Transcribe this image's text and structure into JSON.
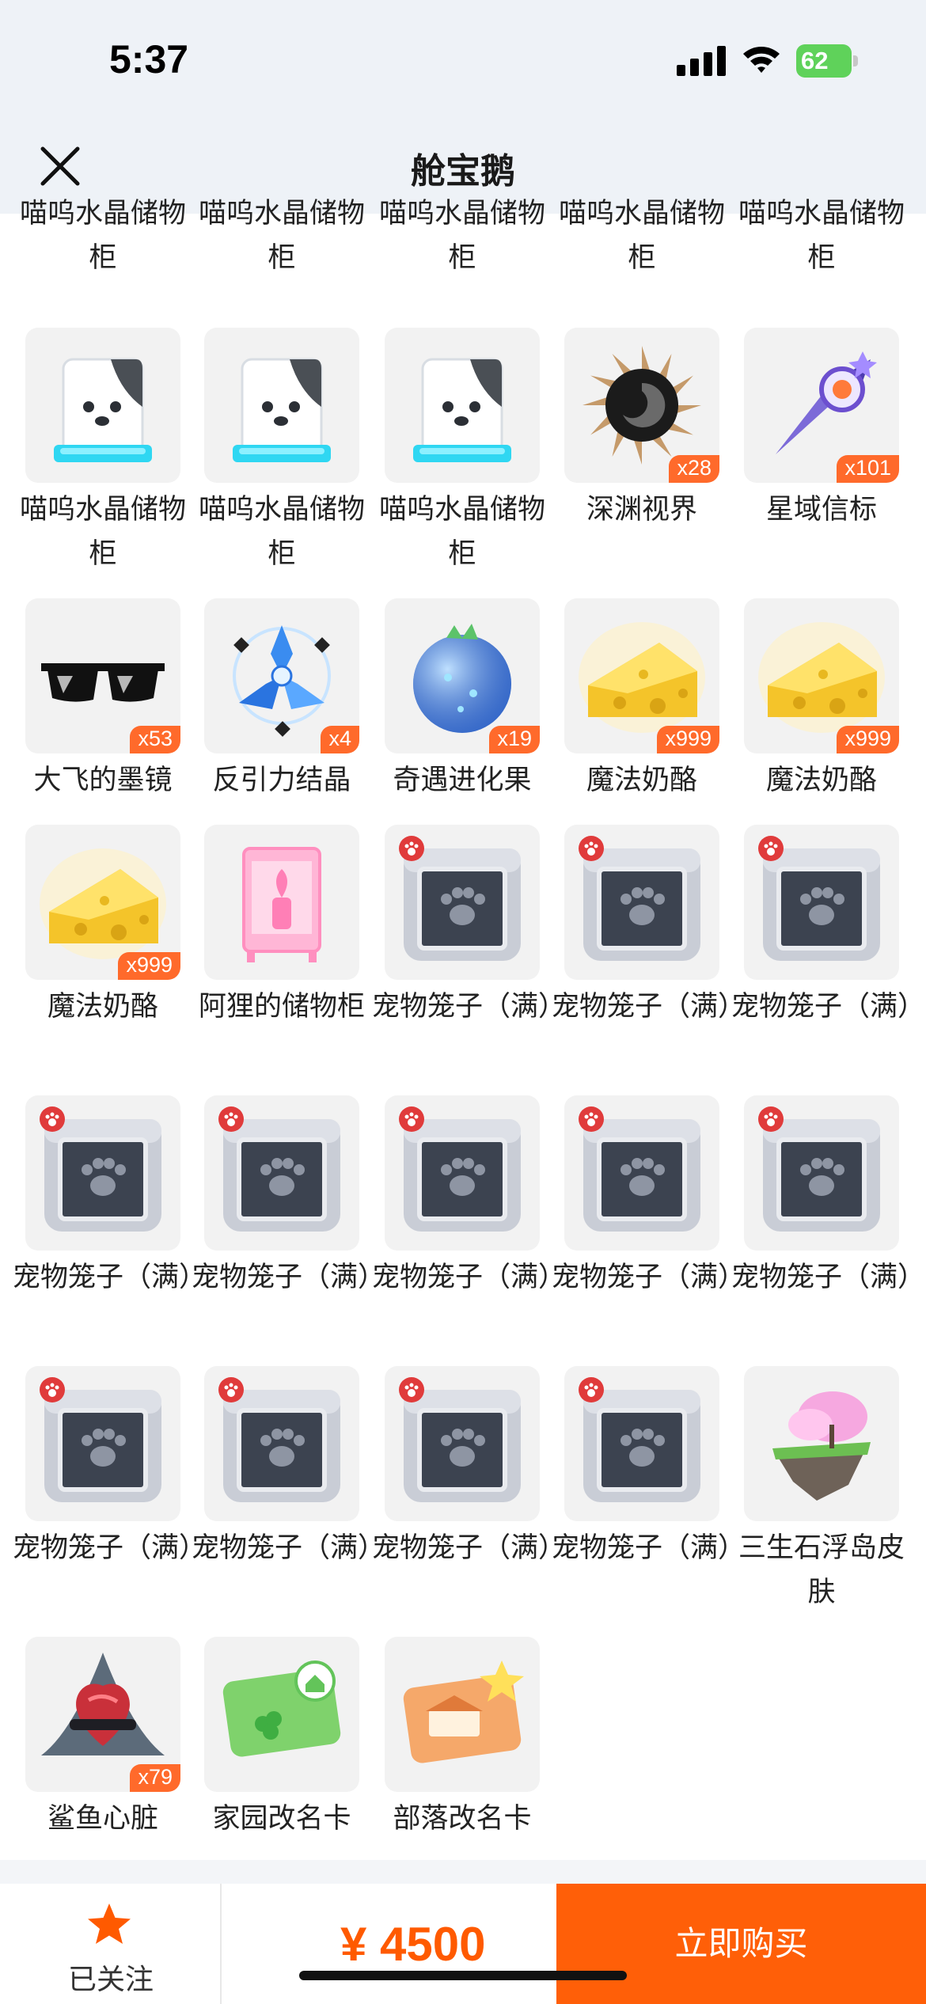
{
  "status_bar": {
    "time": "5:37",
    "battery_percent": "62"
  },
  "header": {
    "title": "舱宝鹅"
  },
  "top_partial_labels": [
    "喵呜水晶储物柜",
    "喵呜水晶储物柜",
    "喵呜水晶储物柜",
    "喵呜水晶储物柜",
    "喵呜水晶储物柜"
  ],
  "items": [
    {
      "label": "喵呜水晶储物柜",
      "count": "",
      "icon": "crystal-cabinet-icon"
    },
    {
      "label": "喵呜水晶储物柜",
      "count": "",
      "icon": "crystal-cabinet-icon"
    },
    {
      "label": "喵呜水晶储物柜",
      "count": "",
      "icon": "crystal-cabinet-icon"
    },
    {
      "label": "深渊视界",
      "count": "x28",
      "icon": "abyss-vision-icon"
    },
    {
      "label": "星域信标",
      "count": "x101",
      "icon": "star-beacon-icon"
    },
    {
      "label": "大飞的墨镜",
      "count": "x53",
      "icon": "sunglasses-icon"
    },
    {
      "label": "反引力结晶",
      "count": "x4",
      "icon": "antigravity-crystal-icon"
    },
    {
      "label": "奇遇进化果",
      "count": "x19",
      "icon": "evolution-fruit-icon"
    },
    {
      "label": "魔法奶酪",
      "count": "x999",
      "icon": "magic-cheese-icon"
    },
    {
      "label": "魔法奶酪",
      "count": "x999",
      "icon": "magic-cheese-icon"
    },
    {
      "label": "魔法奶酪",
      "count": "x999",
      "icon": "magic-cheese-icon"
    },
    {
      "label": "阿狸的储物柜",
      "count": "",
      "icon": "pink-cabinet-icon"
    },
    {
      "label": "宠物笼子（满）",
      "count": "",
      "icon": "pet-cage-icon"
    },
    {
      "label": "宠物笼子（满）",
      "count": "",
      "icon": "pet-cage-icon"
    },
    {
      "label": "宠物笼子（满）",
      "count": "",
      "icon": "pet-cage-icon"
    },
    {
      "label": "宠物笼子（满）",
      "count": "",
      "icon": "pet-cage-icon"
    },
    {
      "label": "宠物笼子（满）",
      "count": "",
      "icon": "pet-cage-icon"
    },
    {
      "label": "宠物笼子（满）",
      "count": "",
      "icon": "pet-cage-icon"
    },
    {
      "label": "宠物笼子（满）",
      "count": "",
      "icon": "pet-cage-icon"
    },
    {
      "label": "宠物笼子（满）",
      "count": "",
      "icon": "pet-cage-icon"
    },
    {
      "label": "宠物笼子（满）",
      "count": "",
      "icon": "pet-cage-icon"
    },
    {
      "label": "宠物笼子（满）",
      "count": "",
      "icon": "pet-cage-icon"
    },
    {
      "label": "宠物笼子（满）",
      "count": "",
      "icon": "pet-cage-icon"
    },
    {
      "label": "宠物笼子（满）",
      "count": "",
      "icon": "pet-cage-icon"
    },
    {
      "label": "三生石浮岛皮肤",
      "count": "",
      "icon": "floating-island-icon"
    },
    {
      "label": "鲨鱼心脏",
      "count": "x79",
      "icon": "shark-heart-icon"
    },
    {
      "label": "家园改名卡",
      "count": "",
      "icon": "home-rename-card-icon"
    },
    {
      "label": "部落改名卡",
      "count": "",
      "icon": "tribe-rename-card-icon"
    }
  ],
  "bottom_bar": {
    "follow_label": "已关注",
    "price": "¥ 4500",
    "buy_label": "立即购买"
  },
  "colors": {
    "accent": "#ff5f08",
    "badge": "#ff6a2b",
    "header_bg": "#eef2f7"
  }
}
